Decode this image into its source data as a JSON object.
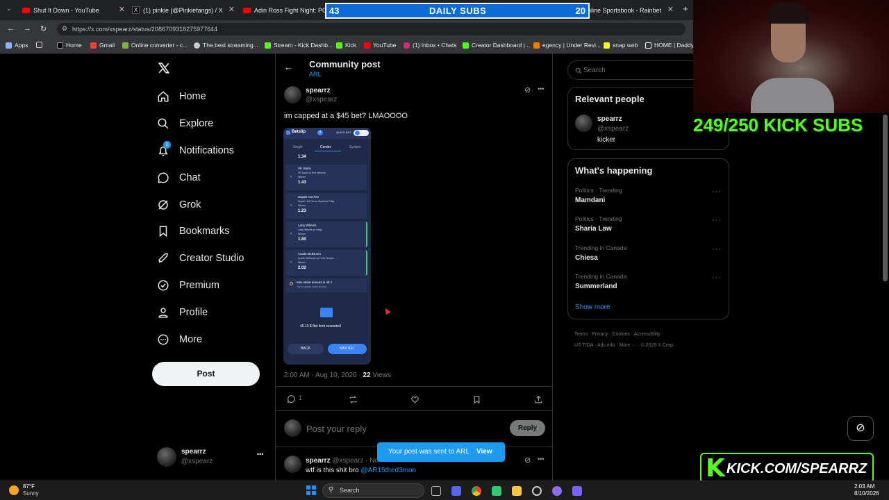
{
  "tabs": [
    {
      "label": "Shut It Down - YouTube"
    },
    {
      "label": "(1) pinkie (@Pinkiefangs) / X"
    },
    {
      "label": "Adin Ross Fight Night: POWE"
    },
    {
      "label": "nline Sportsbook - Rainbet"
    }
  ],
  "url": "https://x.com/xspearz/status/2086709318275977644",
  "bookmarks": [
    "Apps",
    "Home",
    "Gmail",
    "Online converter - c...",
    "The best streaming...",
    "Stream - Kick Dashb...",
    "Kick",
    "YouTube",
    "(1) Inbox • Chats",
    "Creator Dashboard |...",
    "egency | Under Revi...",
    "snap web",
    "HOME | DaddyL"
  ],
  "overlay": {
    "left": "43",
    "title": "DAILY SUBS",
    "right": "20",
    "kick_subs": "249/250 KICK SUBS",
    "kick_url": "KICK.COM/SPEARRZ"
  },
  "nav": {
    "home": "Home",
    "explore": "Explore",
    "notifications": "Notifications",
    "notif_badge": "1",
    "chat": "Chat",
    "grok": "Grok",
    "bookmarks": "Bookmarks",
    "creator": "Creator Studio",
    "premium": "Premium",
    "profile": "Profile",
    "more": "More",
    "post_button": "Post"
  },
  "account": {
    "name": "spearrz",
    "handle": "@xspearz",
    "more": "•••"
  },
  "header": {
    "title": "Community post",
    "community": "ARL"
  },
  "post": {
    "name": "spearrz",
    "handle": "@xspearz",
    "text": "im capped at a $45 bet? LMAOOOO",
    "time": "2:00 AM · Aug 10, 2026 · ",
    "views": "22",
    "views_label": " Views",
    "replies": "1"
  },
  "betslip": {
    "title": "Betslip",
    "count": "4",
    "quick_bet": "QUICK BET",
    "tabs": [
      "Single",
      "Combo",
      "System"
    ],
    "odds_top": "1.34",
    "legs": [
      {
        "name": "VK Dairis",
        "detail": "VK Dairis vs Bob Memory",
        "market": "Winner",
        "odds": "1.43"
      },
      {
        "name": "Supah Hot Fire",
        "detail": "Supah Hot Fire vs Supreme Patty",
        "market": "Winner",
        "odds": "1.23"
      },
      {
        "name": "Larry Wheels",
        "detail": "Larry Wheels vs Vitaly",
        "market": "Winner",
        "odds": "1.80"
      },
      {
        "name": "Austin McBroom",
        "detail": "Austin McBroom vs FaZe Temper",
        "market": "Winner",
        "odds": "2.02"
      }
    ],
    "max_stake": "Max stake amount is 45.1",
    "max_stake_sub": "Tap to update stake amount.",
    "limit": "45.10 $ Bet limit exceeded",
    "back": "BACK",
    "max_bet": "MAX BET"
  },
  "reply_box": {
    "placeholder": "Post your reply",
    "button": "Reply"
  },
  "reply": {
    "name": "spearrz",
    "handle": "@xspearz",
    "extra": "· No",
    "text": "wtf is this shit bro ",
    "mention": "@AR15thed3mon"
  },
  "toast": {
    "text": "Your post was sent to ARL",
    "view": "View"
  },
  "search": {
    "placeholder": "Search"
  },
  "relevant": {
    "title": "Relevant people",
    "name": "spearrz",
    "handle": "@xspearz",
    "bio": "kicker"
  },
  "happening": {
    "title": "What's happening",
    "items": [
      {
        "context": "Politics · Trending",
        "topic": "Mamdani"
      },
      {
        "context": "Politics · Trending",
        "topic": "Sharia Law"
      },
      {
        "context": "Trending in Canada",
        "topic": "Chiesa"
      },
      {
        "context": "Trending in Canada",
        "topic": "Summerland"
      }
    ],
    "show_more": "Show more"
  },
  "footer": {
    "links": [
      "Terms",
      "Privacy",
      "Cookies",
      "Accessibility",
      "US TIDA",
      "Ads info",
      "More ···",
      "© 2026 X Corp."
    ]
  },
  "taskbar": {
    "temp": "87°F",
    "weather": "Sunny",
    "search": "Search",
    "time": "2:03 AM",
    "date": "8/10/2026"
  },
  "colors": {
    "accent": "#1d9bf0",
    "kick_green": "#53fc18",
    "subs_blue": "#0d6bd6"
  }
}
